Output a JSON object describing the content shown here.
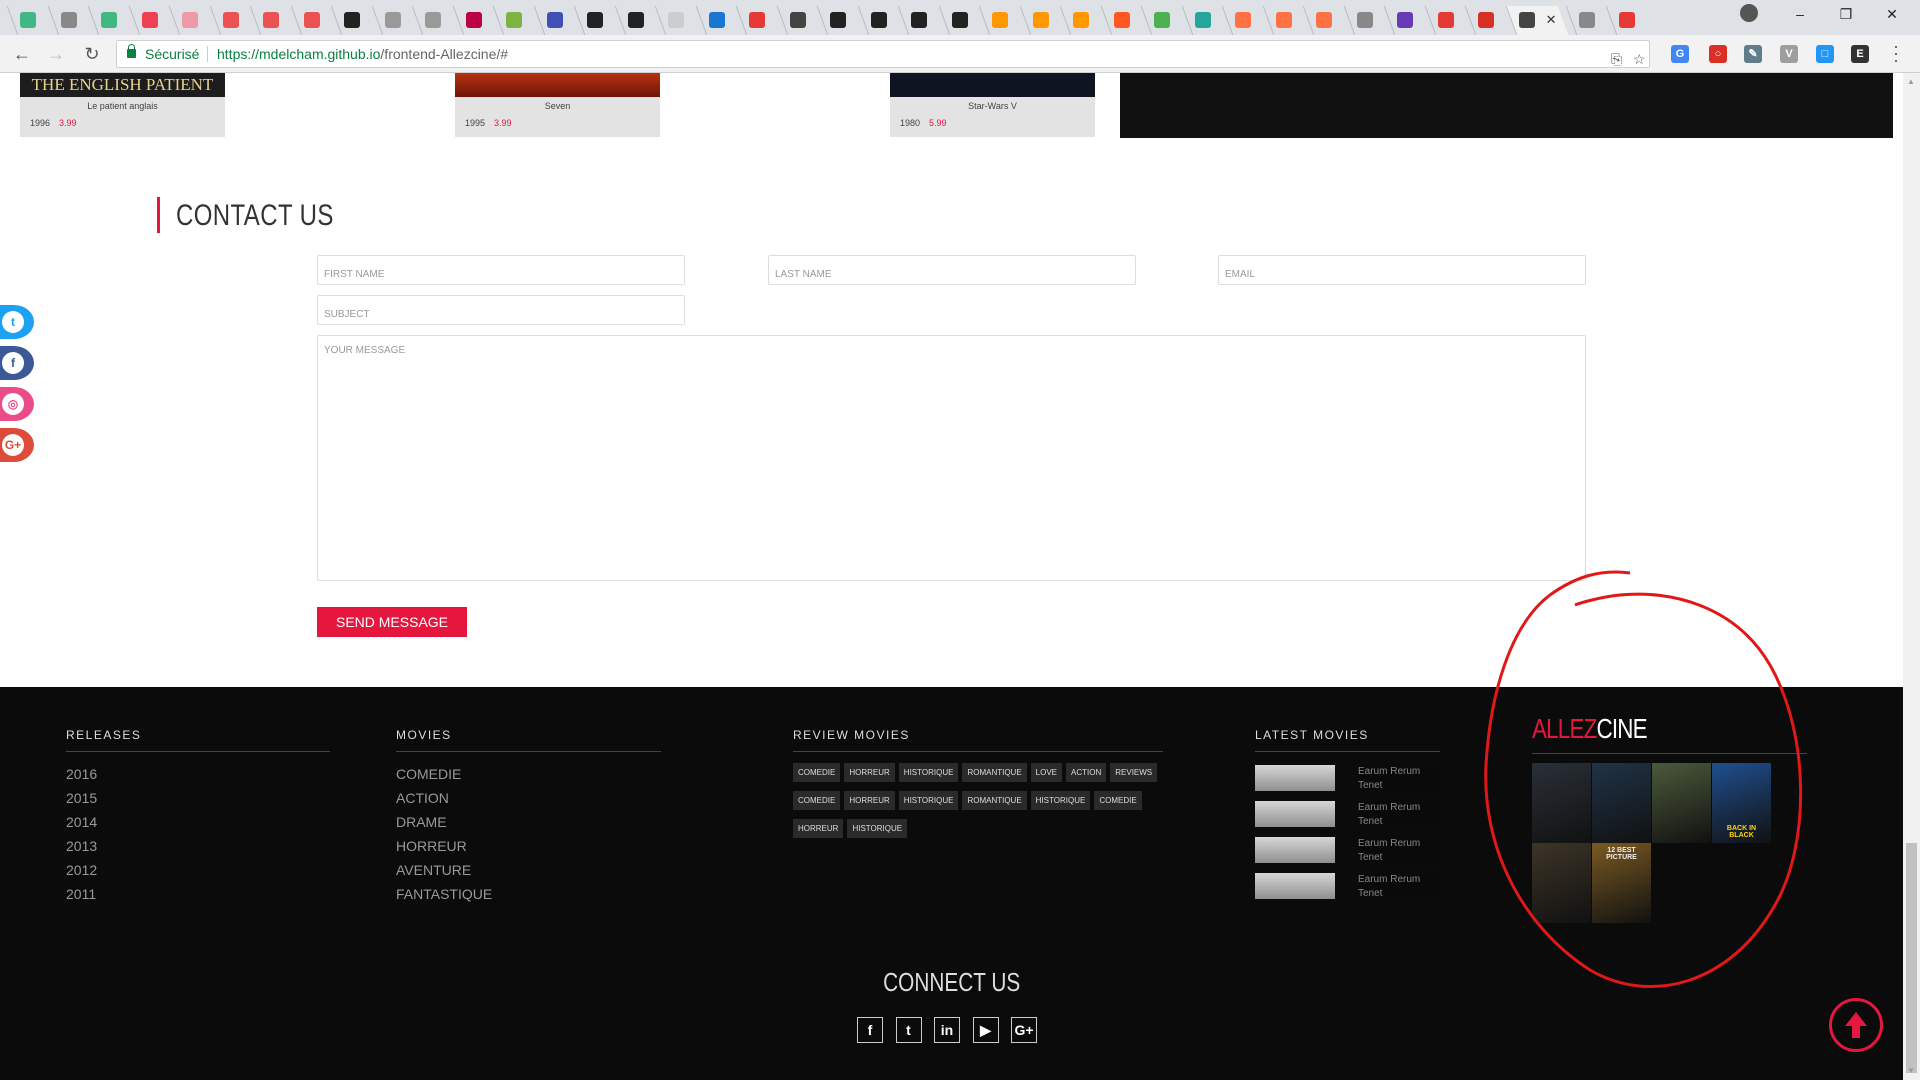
{
  "browser": {
    "tabs": [
      {
        "icon": "vue-icon",
        "color": "#41b883"
      },
      {
        "icon": "page-icon",
        "color": "#888"
      },
      {
        "icon": "vue-icon",
        "color": "#41b883"
      },
      {
        "icon": "pocket-icon",
        "color": "#ef4056"
      },
      {
        "icon": "udemy-icon",
        "color": "#e9a"
      },
      {
        "icon": "udemy-icon",
        "color": "#ec5252"
      },
      {
        "icon": "udemy-icon",
        "color": "#ec5252"
      },
      {
        "icon": "udemy-icon",
        "color": "#ec5252"
      },
      {
        "icon": "github-icon",
        "color": "#222"
      },
      {
        "icon": "globe-icon",
        "color": "#999"
      },
      {
        "icon": "globe-icon",
        "color": "#999"
      },
      {
        "icon": "pen-icon",
        "color": "#b04"
      },
      {
        "icon": "leaf-icon",
        "color": "#7cb342"
      },
      {
        "icon": "help-icon",
        "color": "#3f51b5"
      },
      {
        "icon": "github-icon",
        "color": "#222"
      },
      {
        "icon": "github-icon",
        "color": "#222"
      },
      {
        "icon": "blank-icon",
        "color": "#ccc"
      },
      {
        "icon": "link-icon",
        "color": "#1976d2"
      },
      {
        "icon": "record-icon",
        "color": "#e53935"
      },
      {
        "icon": "book-icon",
        "color": "#444"
      },
      {
        "icon": "github-icon",
        "color": "#222"
      },
      {
        "icon": "github-icon",
        "color": "#222"
      },
      {
        "icon": "github-icon",
        "color": "#222"
      },
      {
        "icon": "github-icon",
        "color": "#222"
      },
      {
        "icon": "wave-icon",
        "color": "#ff9800"
      },
      {
        "icon": "wave-icon",
        "color": "#ff9800"
      },
      {
        "icon": "wave-icon",
        "color": "#ff9800"
      },
      {
        "icon": "terminal-icon",
        "color": "#ff5722"
      },
      {
        "icon": "box-icon",
        "color": "#4caf50"
      },
      {
        "icon": "bird-icon",
        "color": "#26a69a"
      },
      {
        "icon": "brain-icon",
        "color": "#ff7043"
      },
      {
        "icon": "brain-icon",
        "color": "#ff7043"
      },
      {
        "icon": "brain-icon",
        "color": "#ff7043"
      },
      {
        "icon": "page-icon",
        "color": "#888"
      },
      {
        "icon": "form-icon",
        "color": "#673ab7"
      },
      {
        "icon": "runner-icon",
        "color": "#e53935"
      },
      {
        "icon": "gmail-icon",
        "color": "#d93025"
      },
      {
        "icon": "active-tab-icon",
        "color": "#444"
      },
      {
        "icon": "page-icon",
        "color": "#888"
      },
      {
        "icon": "tsc-icon",
        "color": "#e53935"
      }
    ],
    "secure_label": "Sécurisé",
    "url_host": "https://mdelcham.github.io",
    "url_path": "/frontend-Allezcine/#"
  },
  "movies": [
    {
      "poster_text": "THE ENGLISH PATIENT",
      "title": "Le patient anglais",
      "year": "1996",
      "price": "3.99"
    },
    {
      "poster_text": "",
      "title": "Seven",
      "year": "1995",
      "price": "3.99"
    },
    {
      "poster_text": "",
      "title": "Star-Wars V",
      "year": "1980",
      "price": "5.99"
    }
  ],
  "contact": {
    "title": "CONTACT US",
    "first_name_placeholder": "FIRST NAME",
    "last_name_placeholder": "LAST NAME",
    "email_placeholder": "EMAIL",
    "subject_placeholder": "SUBJECT",
    "message_placeholder": "YOUR MESSAGE",
    "send_label": "SEND MESSAGE"
  },
  "social_rail": [
    {
      "icon": "twitter-icon",
      "glyph": "t",
      "color": "#1da1f2"
    },
    {
      "icon": "facebook-icon",
      "glyph": "f",
      "color": "#3b5998"
    },
    {
      "icon": "dribbble-icon",
      "glyph": "◎",
      "color": "#ea4c89"
    },
    {
      "icon": "google-plus-icon",
      "glyph": "G+",
      "color": "#dd4b39"
    }
  ],
  "footer": {
    "releases": {
      "title": "RELEASES",
      "items": [
        "2016",
        "2015",
        "2014",
        "2013",
        "2012",
        "2011"
      ]
    },
    "movies": {
      "title": "MOVIES",
      "items": [
        "COMEDIE",
        "ACTION",
        "DRAME",
        "HORREUR",
        "AVENTURE",
        "FANTASTIQUE"
      ]
    },
    "review": {
      "title": "REVIEW MOVIES",
      "tags": [
        "COMEDIE",
        "HORREUR",
        "HISTORIQUE",
        "ROMANTIQUE",
        "LOVE",
        "ACTION",
        "REVIEWS",
        "COMEDIE",
        "HORREUR",
        "HISTORIQUE",
        "ROMANTIQUE",
        "HISTORIQUE",
        "COMEDIE",
        "HORREUR",
        "HISTORIQUE"
      ]
    },
    "latest": {
      "title": "LATEST MOVIES",
      "items": [
        "Earum Rerum Tenet",
        "Earum Rerum Tenet",
        "Earum Rerum Tenet",
        "Earum Rerum Tenet"
      ]
    },
    "brand": {
      "part1": "ALLEZ",
      "part2": "CINE"
    },
    "brand_posters": [
      {
        "name": "poster-shutter-island",
        "color": "#2a3038",
        "caption": ""
      },
      {
        "name": "poster-inception",
        "color": "#1f3347",
        "caption": ""
      },
      {
        "name": "poster-intouchables",
        "color": "#4c5a3a",
        "caption": ""
      },
      {
        "name": "poster-lego-batman",
        "color": "#1f4f8f",
        "caption": "BACK IN BLACK"
      },
      {
        "name": "poster-monsters",
        "color": "#3d3528",
        "caption": ""
      },
      {
        "name": "poster-english-patient",
        "color": "#7a5a22",
        "caption": "12 BEST PICTURE"
      }
    ],
    "connect_title": "CONNECT US",
    "connect_icons": [
      {
        "icon": "facebook-icon",
        "glyph": "f"
      },
      {
        "icon": "twitter-icon",
        "glyph": "t"
      },
      {
        "icon": "linkedin-icon",
        "glyph": "in"
      },
      {
        "icon": "youtube-icon",
        "glyph": "▶"
      },
      {
        "icon": "google-plus-icon",
        "glyph": "G+"
      }
    ]
  },
  "colors": {
    "accent": "#e5173f",
    "footer_bg": "#0b0b0b"
  }
}
